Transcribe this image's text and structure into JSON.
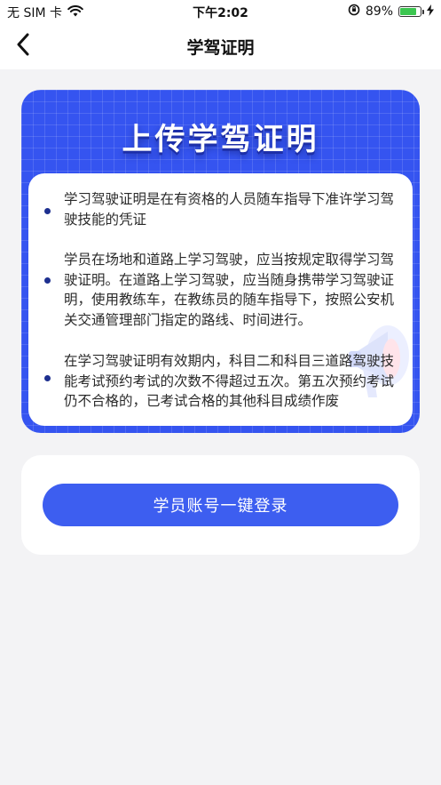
{
  "status_bar": {
    "carrier": "无 SIM 卡",
    "time": "下午2:02",
    "battery_percent": "89%",
    "battery_level": 0.89,
    "battery_color": "#3cc650"
  },
  "nav": {
    "back_icon": "chevron-left-icon",
    "title": "学驾证明"
  },
  "info_card": {
    "title": "上传学驾证明",
    "accent_color": "#3554f0",
    "items": [
      {
        "text": "学习驾驶证明是在有资格的人员随车指导下准许学习驾驶技能的凭证"
      },
      {
        "text": "学员在场地和道路上学习驾驶，应当按规定取得学习驾驶证明。在道路上学习驾驶，应当随身携带学习驾驶证明，使用教练车，在教练员的随车指导下，按照公安机关交通管理部门指定的路线、时间进行。"
      },
      {
        "text": "在学习驾驶证明有效期内，科目二和科目三道路驾驶技能考试预约考试的次数不得超过五次。第五次预约考试仍不合格的，已考试合格的其他科目成绩作废"
      }
    ]
  },
  "login": {
    "button_label": "学员账号一键登录",
    "button_color": "#3d5ef0"
  }
}
